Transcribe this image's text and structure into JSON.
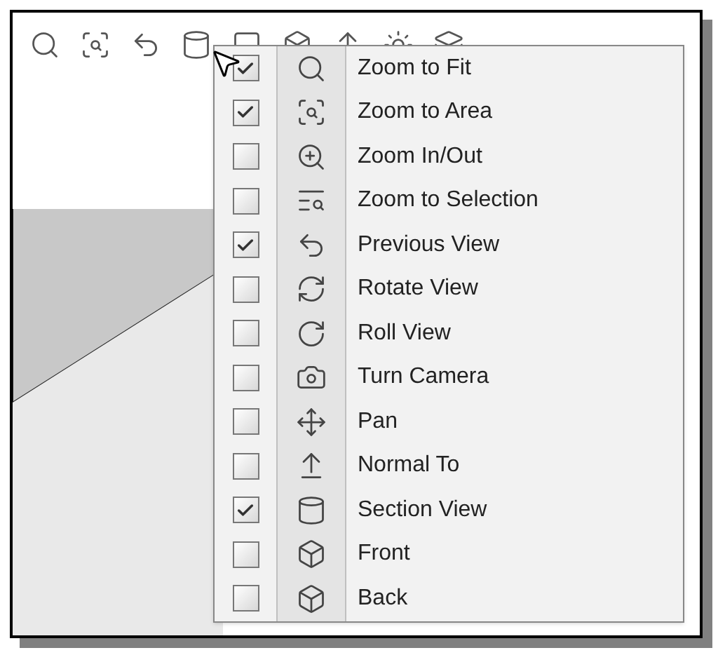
{
  "menu": {
    "items": [
      {
        "label": "Zoom to Fit",
        "checked": true
      },
      {
        "label": "Zoom to Area",
        "checked": true
      },
      {
        "label": "Zoom In/Out",
        "checked": false
      },
      {
        "label": "Zoom to Selection",
        "checked": false
      },
      {
        "label": "Previous View",
        "checked": true
      },
      {
        "label": "Rotate View",
        "checked": false
      },
      {
        "label": "Roll View",
        "checked": false
      },
      {
        "label": "Turn Camera",
        "checked": false
      },
      {
        "label": "Pan",
        "checked": false
      },
      {
        "label": "Normal To",
        "checked": false
      },
      {
        "label": "Section View",
        "checked": true
      },
      {
        "label": "Front",
        "checked": false
      },
      {
        "label": "Back",
        "checked": false
      }
    ]
  }
}
